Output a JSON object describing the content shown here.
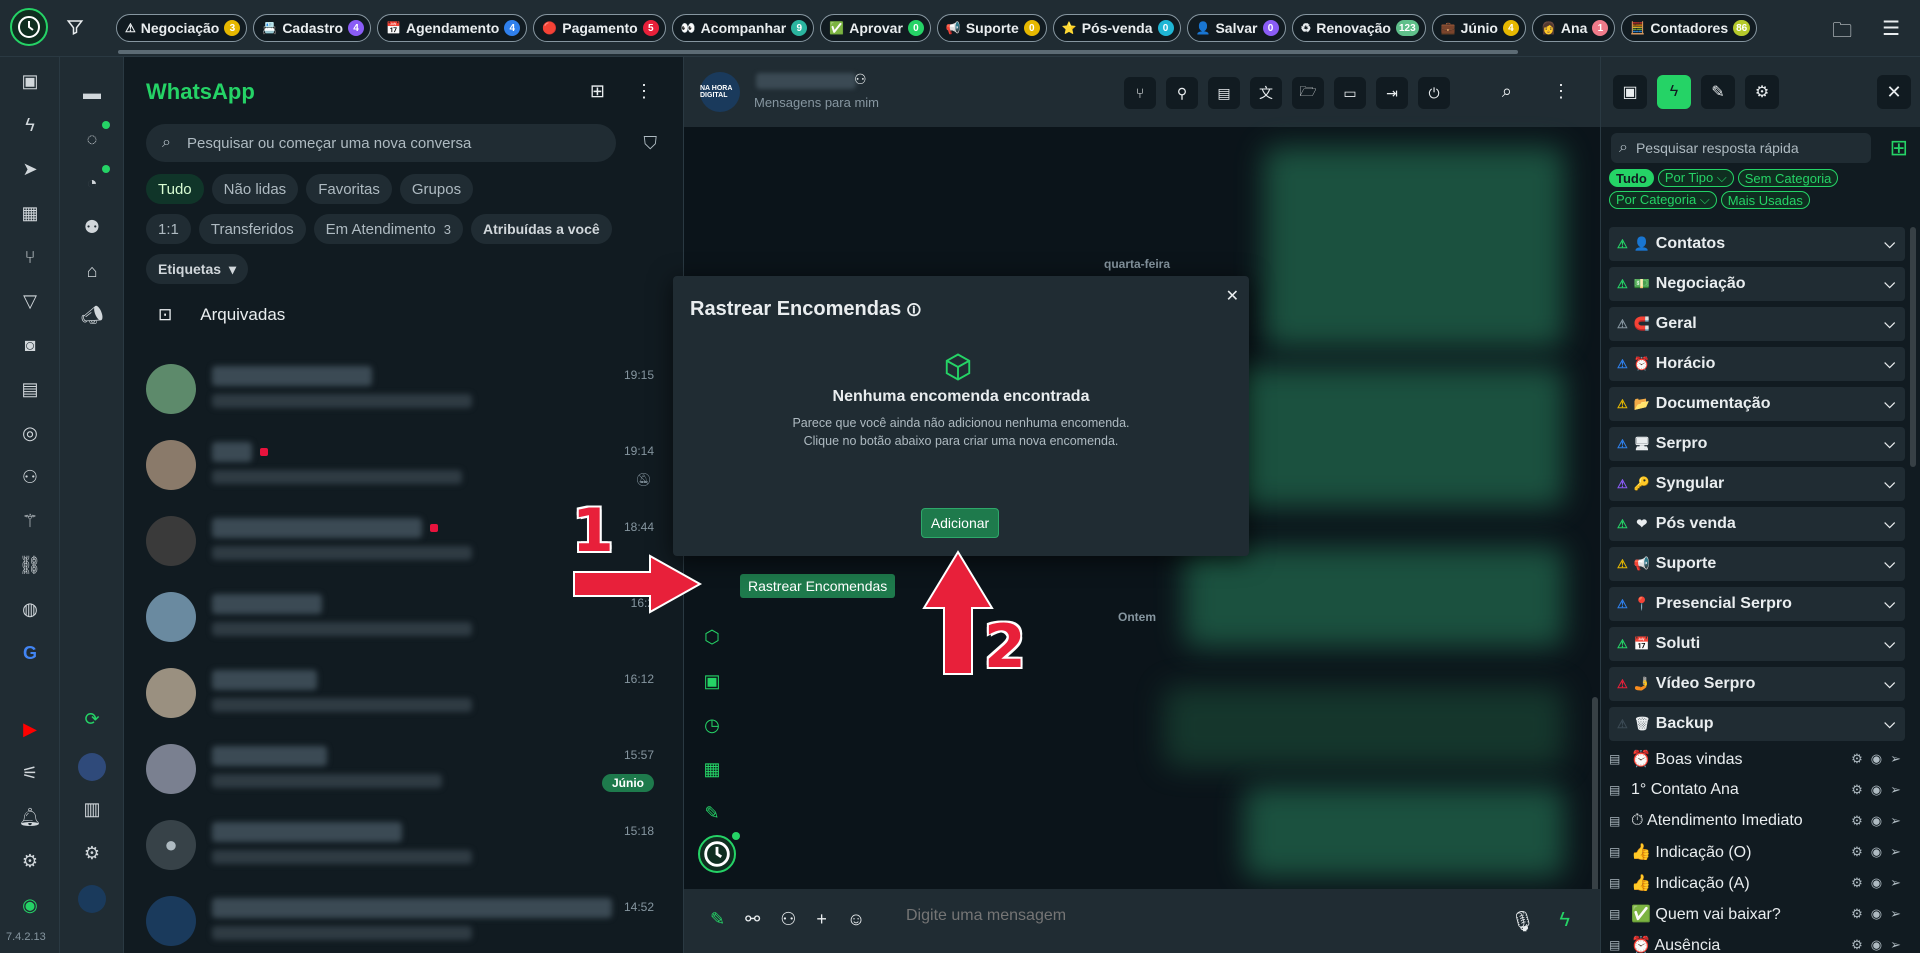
{
  "tagbar": {
    "tags": [
      {
        "icon": "⚠",
        "label": "Negociação",
        "count": "3",
        "color": "#e6b800"
      },
      {
        "icon": "📇",
        "label": "Cadastro",
        "count": "4",
        "color": "#8a5cf6"
      },
      {
        "icon": "📅",
        "label": "Agendamento",
        "count": "4",
        "color": "#2f80ed"
      },
      {
        "icon": "🔴",
        "label": "Pagamento",
        "count": "5",
        "color": "#e8203a"
      },
      {
        "icon": "👀",
        "label": "Acompanhar",
        "count": "9",
        "color": "#2bb5a0"
      },
      {
        "icon": "✅",
        "label": "Aprovar",
        "count": "0",
        "color": "#25d366"
      },
      {
        "icon": "📢",
        "label": "Suporte",
        "count": "0",
        "color": "#e6b800"
      },
      {
        "icon": "⭐",
        "label": "Pós-venda",
        "count": "0",
        "color": "#1fb6d5"
      },
      {
        "icon": "👤",
        "label": "Salvar",
        "count": "0",
        "color": "#8a5cf6"
      },
      {
        "icon": "♻",
        "label": "Renovação",
        "count": "123",
        "color": "#5fbf8a"
      },
      {
        "icon": "💼",
        "label": "Júnio",
        "count": "4",
        "color": "#e6b800"
      },
      {
        "icon": "👩",
        "label": "Ana",
        "count": "1",
        "color": "#f07b8a"
      },
      {
        "icon": "🧮",
        "label": "Contadores",
        "count": "86",
        "color": "#b5c92b"
      }
    ]
  },
  "version": "7.4.2.13",
  "chatlist": {
    "title": "WhatsApp",
    "search_placeholder": "Pesquisar ou começar uma nova conversa",
    "chips_row1": [
      {
        "label": "Tudo",
        "active": true
      },
      {
        "label": "Não lidas"
      },
      {
        "label": "Favoritas"
      },
      {
        "label": "Grupos"
      }
    ],
    "chips_row2": [
      {
        "label": "1:1"
      },
      {
        "label": "Transferidos"
      },
      {
        "label": "Em Atendimento",
        "count": "3"
      },
      {
        "label": "Atribuídas a você"
      }
    ],
    "etiquetas": "Etiquetas",
    "archived": "Arquivadas",
    "chats": [
      {
        "time": "19:15"
      },
      {
        "time": "19:14"
      },
      {
        "time": "18:44"
      },
      {
        "time": "16:2"
      },
      {
        "time": "16:12"
      },
      {
        "time": "15:57",
        "badge": "Júnio"
      },
      {
        "time": "15:18"
      },
      {
        "time": "14:52"
      }
    ]
  },
  "conversation": {
    "avatar_text": "NA HORA DIGITAL",
    "subtitle": "Mensagens para mim",
    "day1": "quarta-feira",
    "day2": "Ontem",
    "composer_placeholder": "Digite uma mensagem",
    "tooltip": "Rastrear Encomendas"
  },
  "modal": {
    "title": "Rastrear Encomendas",
    "heading": "Nenhuma encomenda encontrada",
    "body": "Parece que você ainda não adicionou nenhuma encomenda. Clique no botão abaixo para criar uma nova encomenda.",
    "button": "Adicionar"
  },
  "annotations": {
    "one": "1",
    "two": "2"
  },
  "quick_panel": {
    "search_placeholder": "Pesquisar resposta rápida",
    "filters": [
      {
        "label": "Tudo",
        "active": true
      },
      {
        "label": "Por Tipo ⌵"
      },
      {
        "label": "Sem Categoria"
      },
      {
        "label": "Por Categoria ⌵"
      },
      {
        "label": "Mais Usadas"
      }
    ],
    "categories": [
      {
        "emoji": "👤",
        "label": "Contatos",
        "tri": "#25d366"
      },
      {
        "emoji": "💵",
        "label": "Negociação",
        "tri": "#25d366"
      },
      {
        "emoji": "🧲",
        "label": "Geral",
        "tri": "#8696a0"
      },
      {
        "emoji": "⏰",
        "label": "Horácio",
        "tri": "#2f80ed"
      },
      {
        "emoji": "📂",
        "label": "Documentação",
        "tri": "#e6b800"
      },
      {
        "emoji": "🖥",
        "label": "Serpro",
        "tri": "#2f80ed"
      },
      {
        "emoji": "🔑",
        "label": "Syngular",
        "tri": "#8a5cf6"
      },
      {
        "emoji": "❤",
        "label": "Pós venda",
        "tri": "#25d366"
      },
      {
        "emoji": "📢",
        "label": "Suporte",
        "tri": "#e6b800"
      },
      {
        "emoji": "📍",
        "label": "Presencial Serpro",
        "tri": "#2f80ed"
      },
      {
        "emoji": "📅",
        "label": "Soluti",
        "tri": "#25d366"
      },
      {
        "emoji": "🤳",
        "label": "Vídeo Serpro",
        "tri": "#e8203a"
      },
      {
        "emoji": "🗑",
        "label": "Backup",
        "tri": "#3b4a54"
      }
    ],
    "replies": [
      {
        "emoji": "⏰",
        "label": "Boas vindas"
      },
      {
        "emoji": "",
        "label": "1° Contato Ana"
      },
      {
        "emoji": "⏱",
        "label": "Atendimento Imediato"
      },
      {
        "emoji": "👍",
        "label": "Indicação (O)"
      },
      {
        "emoji": "👍",
        "label": "Indicação (A)"
      },
      {
        "emoji": "✅",
        "label": "Quem vai baixar?"
      },
      {
        "emoji": "⏰",
        "label": "Ausência"
      }
    ]
  }
}
